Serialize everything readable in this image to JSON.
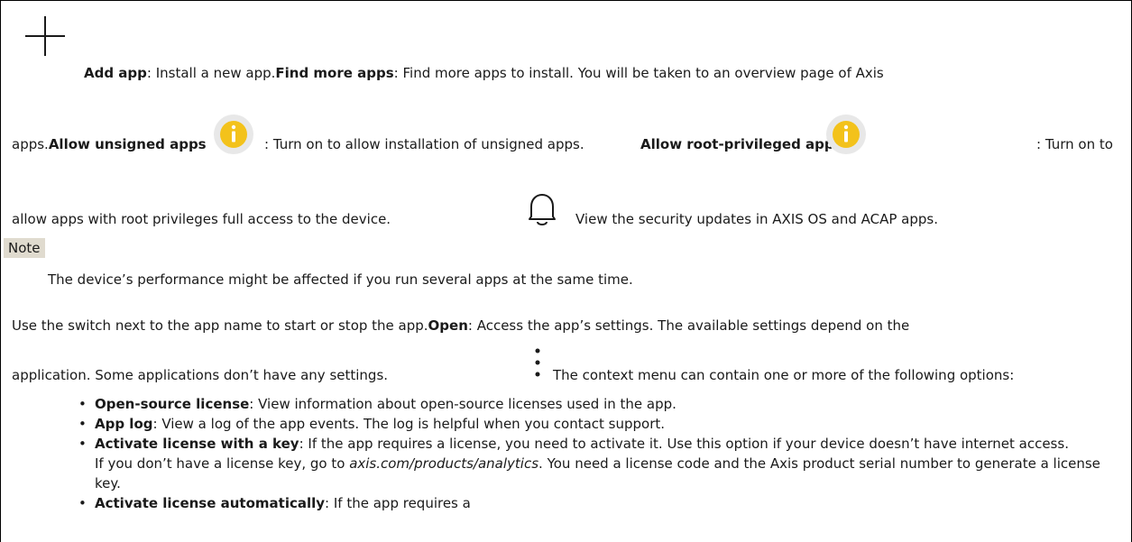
{
  "icons": {
    "add": "plus-icon",
    "info_unsigned": "info-icon",
    "info_root": "info-icon",
    "bell": "bell-icon",
    "context_menu": "vertical-dots-icon"
  },
  "colors": {
    "info_icon": "#f3c21b",
    "note_label_bg": "#e0dbcf"
  },
  "para1": {
    "add_app_label": "Add app",
    "add_app_text": ": Install a new app.",
    "find_more_label": "Find more apps",
    "find_more_text": ": Find more apps to install. You will be taken to an overview page of Axis",
    "line2_start": "apps.",
    "unsigned_label": "Allow unsigned apps",
    "unsigned_text": ": Turn on to allow installation of unsigned apps.",
    "root_label": "Allow root-privileged apps",
    "root_text": ": Turn on to",
    "line3_start": "allow apps with root privileges full access to the device.",
    "security_text": "View the security updates in AXIS OS and ACAP apps."
  },
  "note": {
    "label": "Note",
    "text": "The device’s performance might be affected if you run several apps at the same time."
  },
  "para2": {
    "line1_start": "Use the switch next to the app name to start or stop the app.",
    "open_label": "Open",
    "open_text": ": Access the app’s settings. The available settings depend on the",
    "line2_start": "application. Some applications don’t have any settings.",
    "context_text": "The context menu can contain one or more of the following options:"
  },
  "options": [
    {
      "label": "Open-source license",
      "text": ": View information about open-source licenses used in the app."
    },
    {
      "label": "App log",
      "text": ": View a log of the app events. The log is helpful when you contact support."
    },
    {
      "label": "Activate license with a key",
      "text": ": If the app requires a license, you need to activate it. Use this option if your device doesn’t have internet access."
    },
    {
      "label": "Activate license automatically",
      "text": ": If the app requires a"
    }
  ],
  "license_note": {
    "prefix": "If you don’t have a license key, go to ",
    "link": "axis.com/products/analytics",
    "suffix": ". You need a license code and the Axis product serial number to generate a license key."
  },
  "bullet_char": "•"
}
